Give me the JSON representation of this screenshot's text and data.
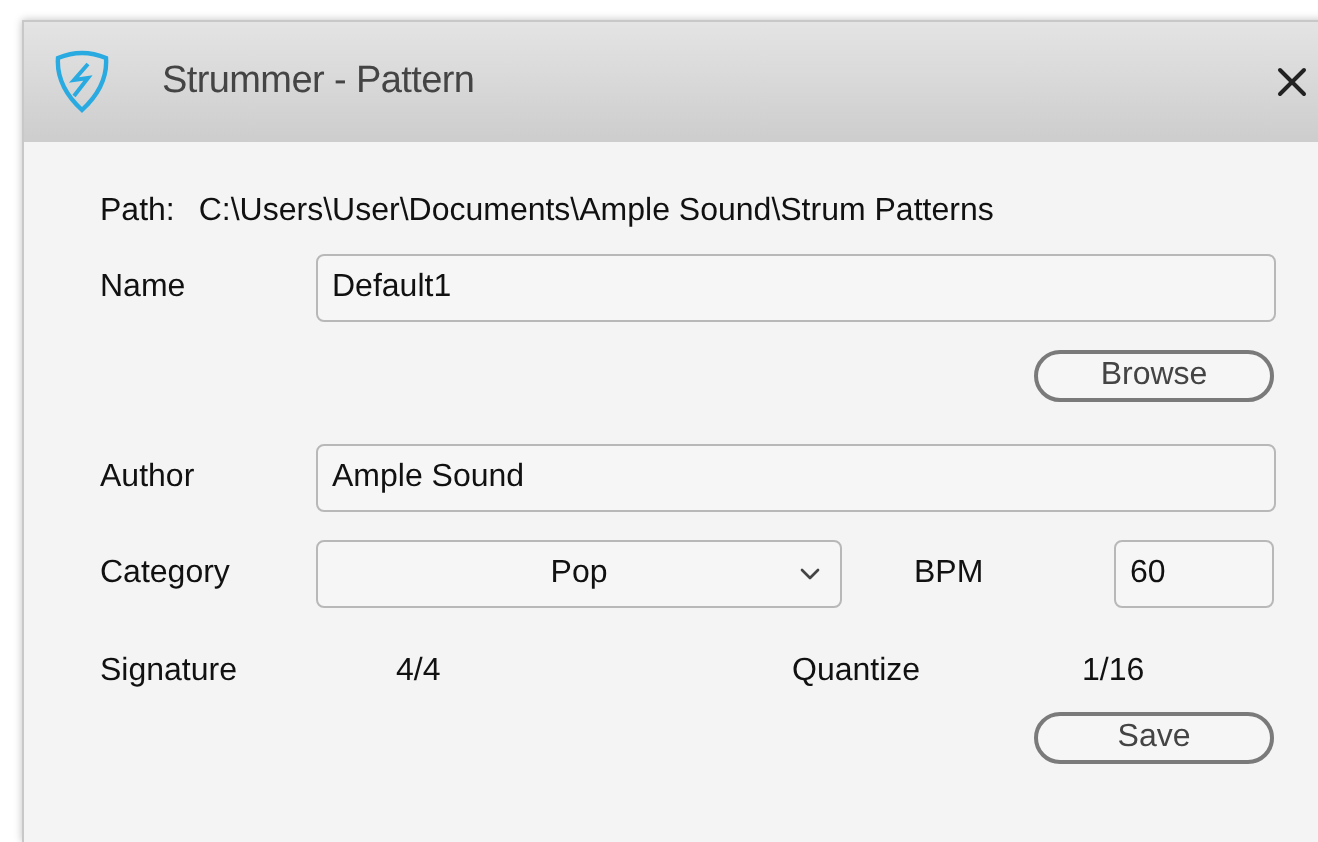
{
  "window": {
    "title": "Strummer - Pattern"
  },
  "path": {
    "label": "Path:",
    "value": "C:\\Users\\User\\Documents\\Ample Sound\\Strum Patterns"
  },
  "name": {
    "label": "Name",
    "value": "Default1"
  },
  "browse_button": "Browse",
  "author": {
    "label": "Author",
    "value": "Ample Sound"
  },
  "category": {
    "label": "Category",
    "value": "Pop"
  },
  "bpm": {
    "label": "BPM",
    "value": "60"
  },
  "signature": {
    "label": "Signature",
    "value": "4/4"
  },
  "quantize": {
    "label": "Quantize",
    "value": "1/16"
  },
  "save_button": "Save"
}
